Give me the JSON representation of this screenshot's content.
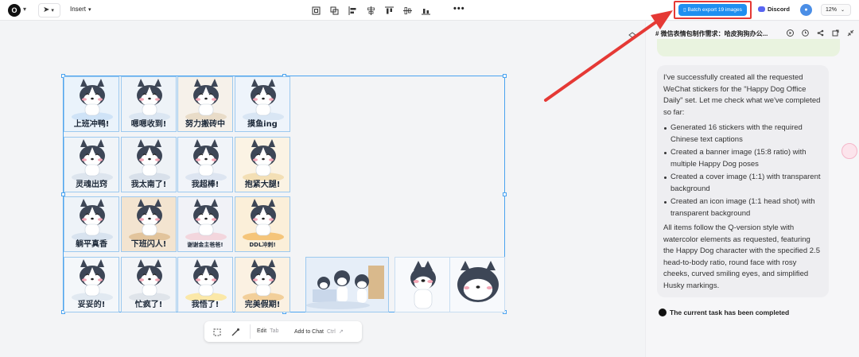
{
  "toolbar": {
    "logo_text": "O",
    "tool_select_glyph": "➤",
    "insert_label": "Insert",
    "more_label": "•••",
    "batch_export_label": "Batch export 19 images",
    "discord_label": "Discord",
    "avatar_initial": "●",
    "zoom_label": "12%"
  },
  "stickers": [
    {
      "caption": "上班冲鸭!",
      "bg": "#eaf3fb",
      "accent": "#cfe3f7"
    },
    {
      "caption": "嗯嗯收到!",
      "bg": "#eef3f8",
      "accent": "#dbe6f2"
    },
    {
      "caption": "努力搬砖中",
      "bg": "#f6f1ea",
      "accent": "#e9dcc8"
    },
    {
      "caption": "摸鱼ing",
      "bg": "#eef4fb",
      "accent": "#d9e6f4"
    },
    {
      "caption": "灵魂出窍",
      "bg": "#f0f4f8",
      "accent": "#dde5ee"
    },
    {
      "caption": "我太南了!",
      "bg": "#eef2f6",
      "accent": "#d8e0ea"
    },
    {
      "caption": "我超棒!",
      "bg": "#f1f4f9",
      "accent": "#dde5f1"
    },
    {
      "caption": "抱紧大腿!",
      "bg": "#fbf3e4",
      "accent": "#f3dfb5"
    },
    {
      "caption": "躺平真香",
      "bg": "#eef3f8",
      "accent": "#d8e3ef"
    },
    {
      "caption": "下班闪人!",
      "bg": "#f3e4d0",
      "accent": "#e2c49c"
    },
    {
      "caption": "谢谢金主爸爸!",
      "bg": "#f1f2f7",
      "accent": "#f3d6dd"
    },
    {
      "caption": "DDL冲刺!",
      "bg": "#fbefd9",
      "accent": "#f5c57a"
    },
    {
      "caption": "妥妥的!",
      "bg": "#f4f7fa",
      "accent": "#e1e9f1"
    },
    {
      "caption": "忙疯了!",
      "bg": "#f2f4f7",
      "accent": "#dfe4ea"
    },
    {
      "caption": "我悟了!",
      "bg": "#f3f5f9",
      "accent": "#fbe8a8"
    },
    {
      "caption": "完美假期!",
      "bg": "#fbf1e2",
      "accent": "#f2cf9a"
    }
  ],
  "bottom_toolbar": {
    "edit_label": "Edit",
    "edit_shortcut": "Tab",
    "add_label": "Add to Chat",
    "add_shortcut": "Ctrl"
  },
  "chat": {
    "title": "# 微信表情包制作需求：哈皮狗狗办公...",
    "intro": "I've successfully created all the requested WeChat stickers for the \"Happy Dog Office Daily\" set. Let me check what we've completed so far:",
    "items": [
      "Generated 16 stickers with the required Chinese text captions",
      "Created a banner image (15:8 ratio) with multiple Happy Dog poses",
      "Created a cover image (1:1) with transparent background",
      "Created an icon image (1:1 head shot) with transparent background"
    ],
    "summary": "All items follow the Q-version style with watercolor elements as requested, featuring the Happy Dog character with the specified 2.5 head-to-body ratio, round face with rosy cheeks, curved smiling eyes, and simplified Husky markings.",
    "status": "The current task has been completed"
  },
  "colors": {
    "export_button": "#1f8ff0",
    "highlight_red": "#e53935",
    "selection_blue": "#4aa3f0",
    "husky_dark": "#3d4656",
    "cheek_pink": "#f4a7b6"
  }
}
